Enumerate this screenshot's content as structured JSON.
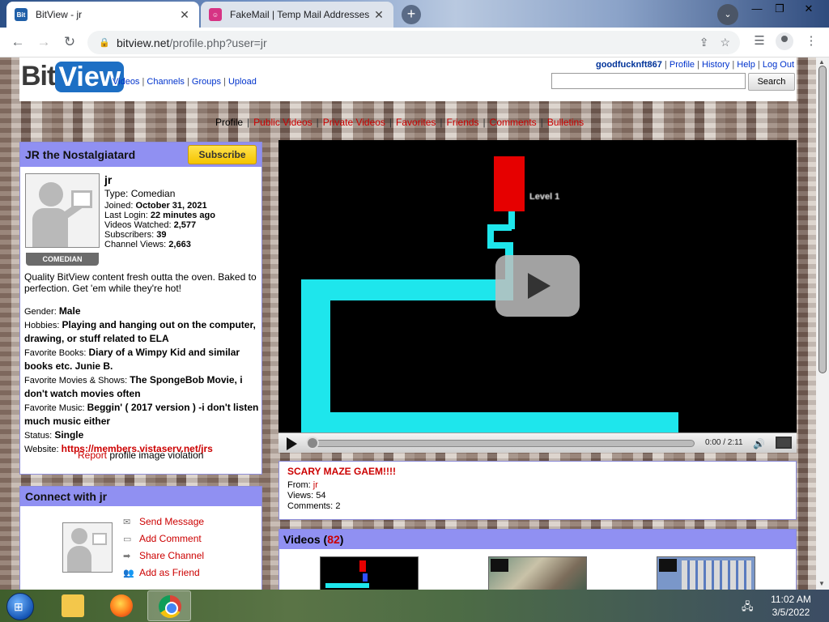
{
  "browser": {
    "tabs": [
      {
        "title": "BitView - jr",
        "favicon": "Bit"
      },
      {
        "title": "FakeMail | Temp Mail Addresses",
        "favicon": "☺"
      }
    ],
    "url_host": "bitview.net",
    "url_path": "/profile.php?user=jr"
  },
  "site": {
    "logo_bit": "Bit",
    "logo_view": "View",
    "nav": [
      "Videos",
      "Channels",
      "Groups",
      "Upload"
    ],
    "user_links": [
      "goodfucknft867",
      "Profile",
      "History",
      "Help",
      "Log Out"
    ],
    "search_button": "Search",
    "search_value": ""
  },
  "profile_tabs": [
    "Profile",
    "Public Videos",
    "Private Videos",
    "Favorites",
    "Friends",
    "Comments",
    "Bulletins"
  ],
  "channel_box": {
    "title": "JR the Nostalgiatard",
    "subscribe": "Subscribe",
    "username": "jr",
    "type_label": "Type:",
    "type": "Comedian",
    "stats": [
      {
        "label": "Joined:",
        "value": "October 31, 2021"
      },
      {
        "label": "Last Login:",
        "value": "22 minutes ago"
      },
      {
        "label": "Videos Watched:",
        "value": "2,577"
      },
      {
        "label": "Subscribers:",
        "value": "39"
      },
      {
        "label": "Channel Views:",
        "value": "2,663"
      }
    ],
    "badge": "COMEDIAN",
    "bio": "Quality BitView content fresh outta the oven. Baked to perfection. Get 'em while they're hot!",
    "info": [
      {
        "label": "Gender:",
        "value": "Male"
      },
      {
        "label": "Hobbies:",
        "value": "Playing and hanging out on the computer, drawing, or stuff related to ELA"
      },
      {
        "label": "Favorite Books:",
        "value": "Diary of a Wimpy Kid and similar books etc. Junie B."
      },
      {
        "label": "Favorite Movies & Shows:",
        "value": "The SpongeBob Movie, i don't watch movies often"
      },
      {
        "label": "Favorite Music:",
        "value": "Beggin' ( 2017 version ) -i don't listen much music either"
      },
      {
        "label": "Status:",
        "value": "Single"
      }
    ],
    "website_label": "Website:",
    "website": "https://members.vistaserv.net/jrs",
    "report_link": "Report",
    "report_text": "profile image violation"
  },
  "connect_box": {
    "title": "Connect with jr",
    "actions": [
      "Send Message",
      "Add Comment",
      "Share Channel",
      "Add as Friend"
    ]
  },
  "player": {
    "overlay_text": "Level 1",
    "time": "0:00 / 2:11",
    "progress": 0
  },
  "video_info": {
    "title": "SCARY MAZE GAEM!!!!",
    "from_label": "From:",
    "from": "jr",
    "views_label": "Views:",
    "views": "54",
    "comments_label": "Comments:",
    "comments": "2"
  },
  "videos_box": {
    "title": "Videos",
    "count": "82"
  },
  "taskbar": {
    "time": "11:02 AM",
    "date": "3/5/2022"
  }
}
